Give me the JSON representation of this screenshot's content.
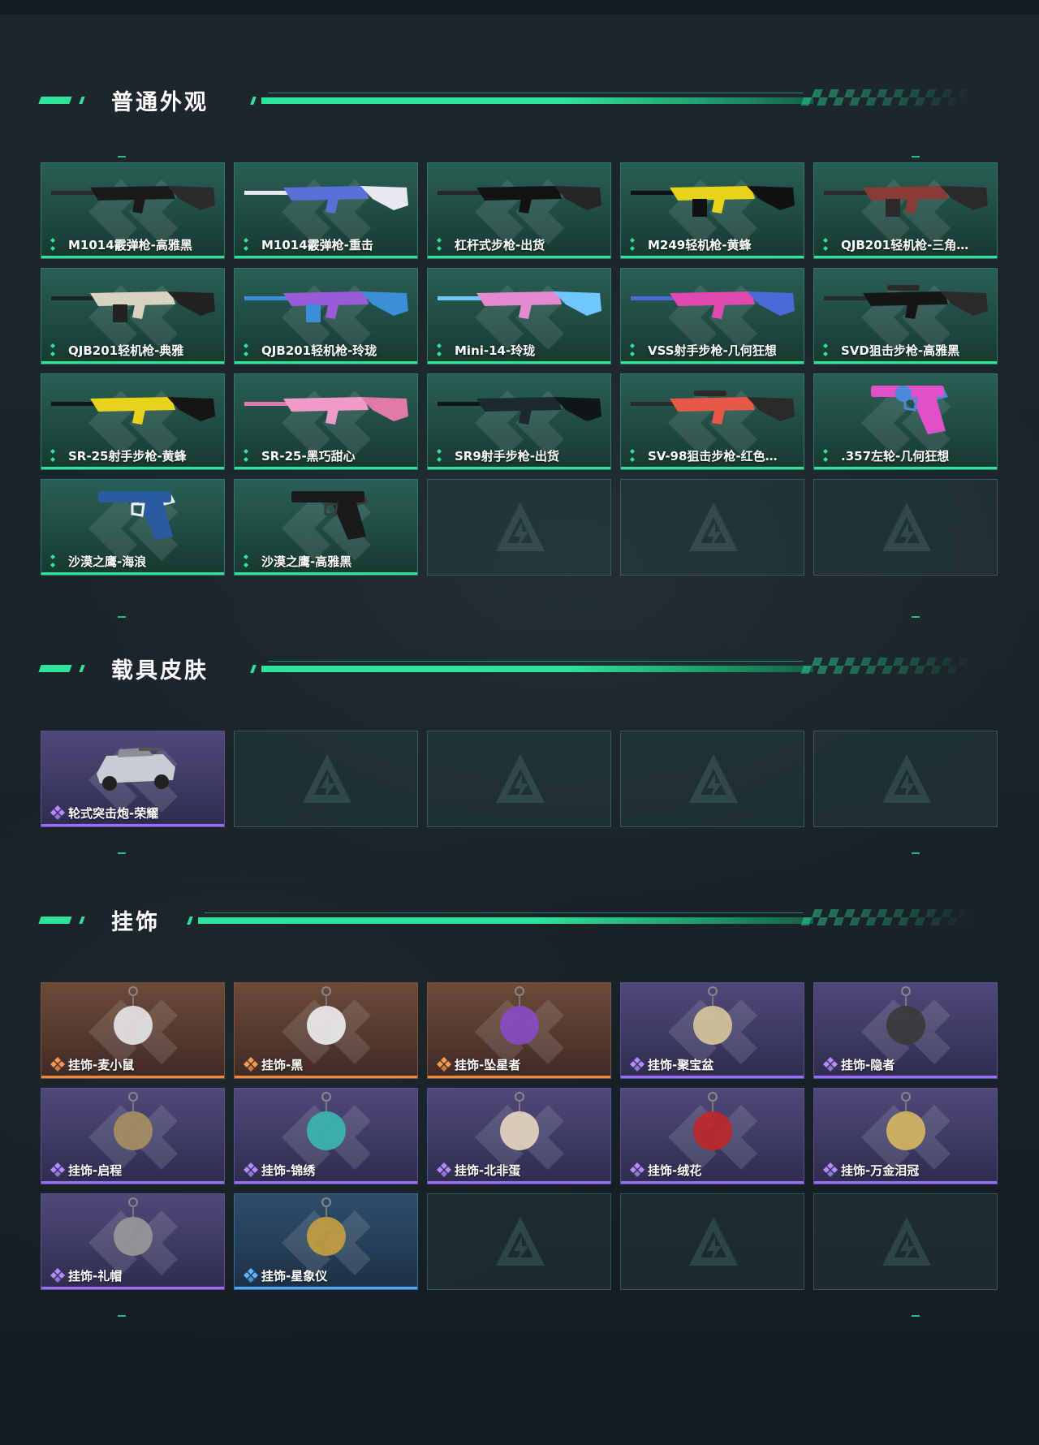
{
  "sections": {
    "normal_skins": {
      "title": "普通外观",
      "items": [
        {
          "label": "M1014霰弹枪-高雅黑",
          "icon": "shotgun-icon"
        },
        {
          "label": "M1014霰弹枪-重击",
          "icon": "shotgun-icon"
        },
        {
          "label": "杠杆式步枪-出货",
          "icon": "rifle-icon"
        },
        {
          "label": "M249轻机枪-黄蜂",
          "icon": "machine-gun-icon"
        },
        {
          "label": "QJB201轻机枪-三角…",
          "icon": "machine-gun-icon"
        },
        {
          "label": "QJB201轻机枪-典雅",
          "icon": "machine-gun-icon"
        },
        {
          "label": "QJB201轻机枪-玲珑",
          "icon": "machine-gun-icon"
        },
        {
          "label": "Mini-14-玲珑",
          "icon": "rifle-icon"
        },
        {
          "label": "VSS射手步枪-几何狂想",
          "icon": "rifle-icon"
        },
        {
          "label": "SVD狙击步枪-高雅黑",
          "icon": "sniper-icon"
        },
        {
          "label": "SR-25射手步枪-黄蜂",
          "icon": "rifle-icon"
        },
        {
          "label": "SR-25-黑巧甜心",
          "icon": "rifle-icon"
        },
        {
          "label": "SR9射手步枪-出货",
          "icon": "rifle-icon"
        },
        {
          "label": "SV-98狙击步枪-红色…",
          "icon": "sniper-icon"
        },
        {
          "label": ".357左轮-几何狂想",
          "icon": "revolver-icon"
        },
        {
          "label": "沙漠之鹰-海浪",
          "icon": "pistol-icon"
        },
        {
          "label": "沙漠之鹰-高雅黑",
          "icon": "pistol-icon"
        }
      ],
      "empty_slots": 3
    },
    "vehicle_skins": {
      "title": "载具皮肤",
      "items": [
        {
          "label": "轮式突击炮-荣耀",
          "icon": "armored-vehicle-icon"
        }
      ],
      "empty_slots": 4
    },
    "charms": {
      "title": "挂饰",
      "items": [
        {
          "label": "挂饰-麦小鼠",
          "rarity": "orange"
        },
        {
          "label": "挂饰-黑",
          "rarity": "orange"
        },
        {
          "label": "挂饰-坠星者",
          "rarity": "orange"
        },
        {
          "label": "挂饰-聚宝盆",
          "rarity": "purple"
        },
        {
          "label": "挂饰-隐者",
          "rarity": "purple"
        },
        {
          "label": "挂饰-启程",
          "rarity": "purple"
        },
        {
          "label": "挂饰-锦绣",
          "rarity": "purple"
        },
        {
          "label": "挂饰-北非蛋",
          "rarity": "purple"
        },
        {
          "label": "挂饰-绒花",
          "rarity": "purple"
        },
        {
          "label": "挂饰-万金泪冠",
          "rarity": "purple"
        },
        {
          "label": "挂饰-礼帽",
          "rarity": "purple"
        },
        {
          "label": "挂饰-星象仪",
          "rarity": "blue"
        }
      ],
      "empty_slots": 3
    }
  },
  "colors": {
    "accent_green": "#2ee39a",
    "rarity_purple": "#9b6cff",
    "rarity_orange": "#f08a3a",
    "rarity_blue": "#4aa8ff"
  }
}
